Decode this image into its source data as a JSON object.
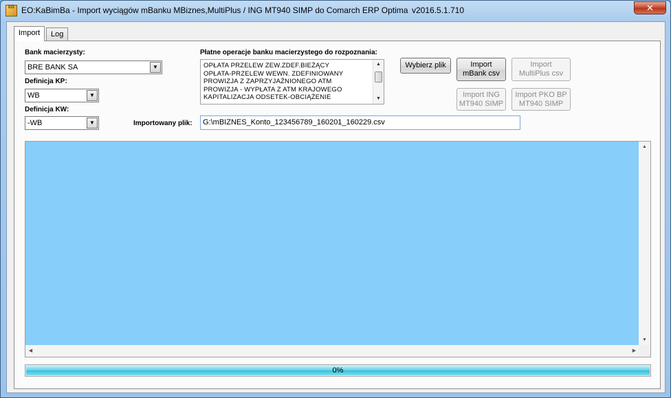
{
  "window": {
    "icon_text": "EO",
    "title": "EO:KaBimBa - Import wyciągów mBanku MBiznes,MultiPlus / ING MT940 SIMP do Comarch ERP Optima",
    "version": "v2016.5.1.710",
    "close_label": "✕"
  },
  "tabs": [
    {
      "label": "Import",
      "active": true
    },
    {
      "label": "Log",
      "active": false
    }
  ],
  "form": {
    "bank_label": "Bank macierzysty:",
    "bank_value": "BRE BANK SA",
    "kp_label": "Definicja KP:",
    "kp_value": "WB",
    "kw_label": "Definicja KW:",
    "kw_value": "-WB",
    "operations_label": "Płatne operacje banku macierzystego do rozpoznania:",
    "operations": [
      "OPŁATA PRZELEW ZEW.ZDEF.BIEŻĄCY",
      "OPŁATA-PRZELEW WEWN. ZDEFINIOWANY",
      "PROWIZJA Z ZAPRZYJAŹNIONEGO ATM",
      "PROWIZJA - WYPŁATA Z ATM KRAJOWEGO",
      "KAPITALIZACJA ODSETEK-OBCIĄŻENIE"
    ],
    "file_label": "Importowany plik:",
    "file_value": "G:\\mBIZNES_Konto_123456789_160201_160229.csv"
  },
  "buttons": {
    "choose_file": "Wybierz plik",
    "import_mbank": [
      "Import",
      "mBank csv"
    ],
    "import_multiplus": [
      "Import",
      "MultiPlus csv"
    ],
    "import_ing": [
      "Import ING",
      "MT940 SIMP"
    ],
    "import_pko": [
      "Import PKO BP",
      "MT940 SIMP"
    ]
  },
  "progress": {
    "value": 1.0,
    "label": "0%"
  },
  "colors": {
    "log_background": "#87CEFA",
    "progress_fill": "#33C1DE"
  }
}
